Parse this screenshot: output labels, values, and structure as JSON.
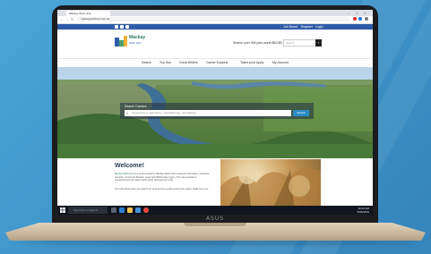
{
  "device": {
    "brand": "ASUS"
  },
  "browser": {
    "tab_title": "Mackay Work Hub",
    "url": "mackayworkhub.com.au",
    "nav_icons": [
      "back-icon",
      "forward-icon",
      "reload-icon",
      "home-icon"
    ]
  },
  "site": {
    "top_links": {
      "job_board": "Job Board",
      "register": "Register",
      "login": "Login"
    },
    "logo": {
      "title": "Mackay",
      "subtitle": "Work Hub"
    },
    "header_text": "Search over 900 jobs worth $63.8B",
    "header_search_placeholder": "Search",
    "header_search_button": "Go",
    "nav": [
      "Search",
      "Top Tips",
      "Great Writers",
      "Career Explorer",
      "Talent pool Apply",
      "My Account"
    ],
    "hero": {
      "search_label": "Search Careers",
      "search_placeholder": "Keyword (e.g. agriculture, manufacturing, renewables)",
      "search_button": "Search"
    },
    "welcome": {
      "title": "Welcome!",
      "para1_link": "Mackay Work Hub",
      "para1": " is a central portal for Mackay Work Hub's local job information, vacancies and jobs, across the Mackay, Isaac and Whitsunday region. This site provides a comprehensive job search and career development tools.",
      "para2": "Our Jobs bank helps you search for work across a great opportunity region. Make sure you..."
    }
  },
  "taskbar": {
    "search_placeholder": "Type here to search",
    "time": "10:24 AM",
    "date": "5/06/2019"
  },
  "colors": {
    "background": "#3d92c9",
    "site_topstrip": "#2f5ba8",
    "brand_green": "#2f7d5b",
    "search_button": "#2b8cc4"
  }
}
